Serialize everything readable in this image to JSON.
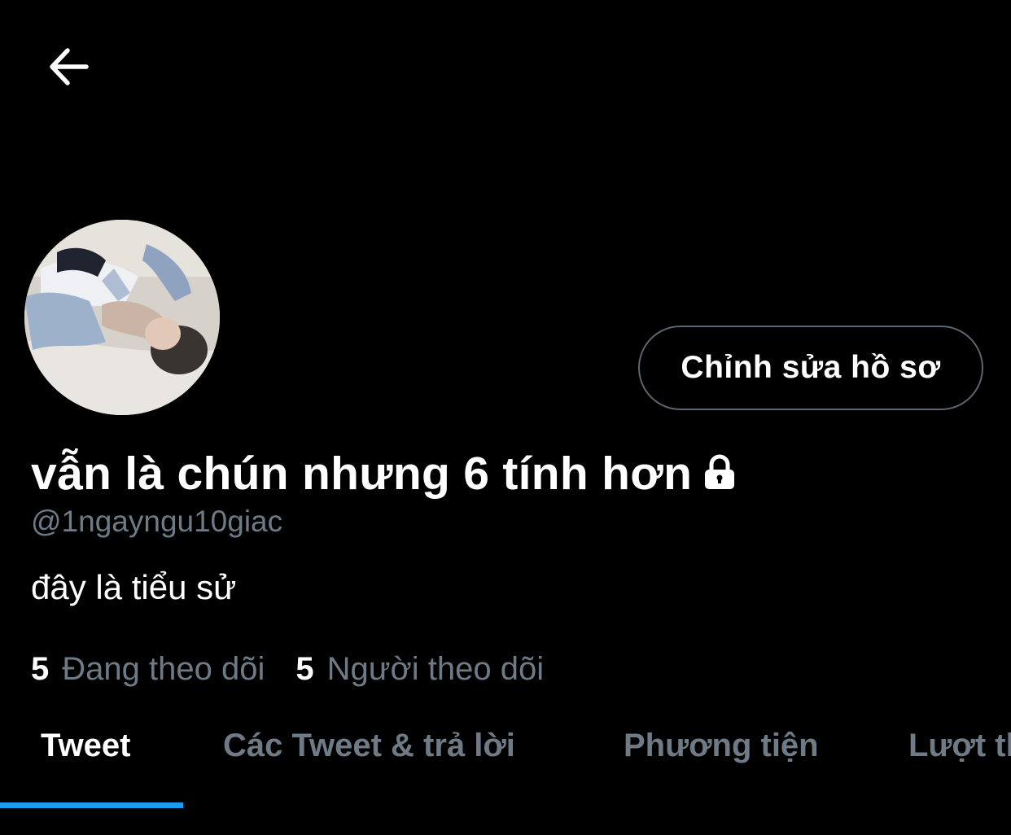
{
  "header": {
    "back_icon": "arrow-left-icon"
  },
  "profile": {
    "avatar_icon": "profile-photo",
    "edit_button_label": "Chỉnh sửa hồ sơ",
    "display_name": "vẫn là chún nhưng 6 tính hơn",
    "protected_icon": "lock-icon",
    "handle": "@1ngayngu10giac",
    "bio": "đây là tiểu sử",
    "following_count": "5",
    "following_label": "Đang theo dõi",
    "followers_count": "5",
    "followers_label": "Người theo dõi"
  },
  "tabs": [
    {
      "label": "Tweet",
      "active": true
    },
    {
      "label": "Các Tweet & trả lời",
      "active": false
    },
    {
      "label": "Phương tiện",
      "active": false
    },
    {
      "label": "Lượt thích",
      "active": false
    }
  ],
  "colors": {
    "background": "#000000",
    "text_primary": "#ffffff",
    "text_secondary": "#6e7a85",
    "accent": "#1d9bf0",
    "button_border": "#5b6670"
  }
}
